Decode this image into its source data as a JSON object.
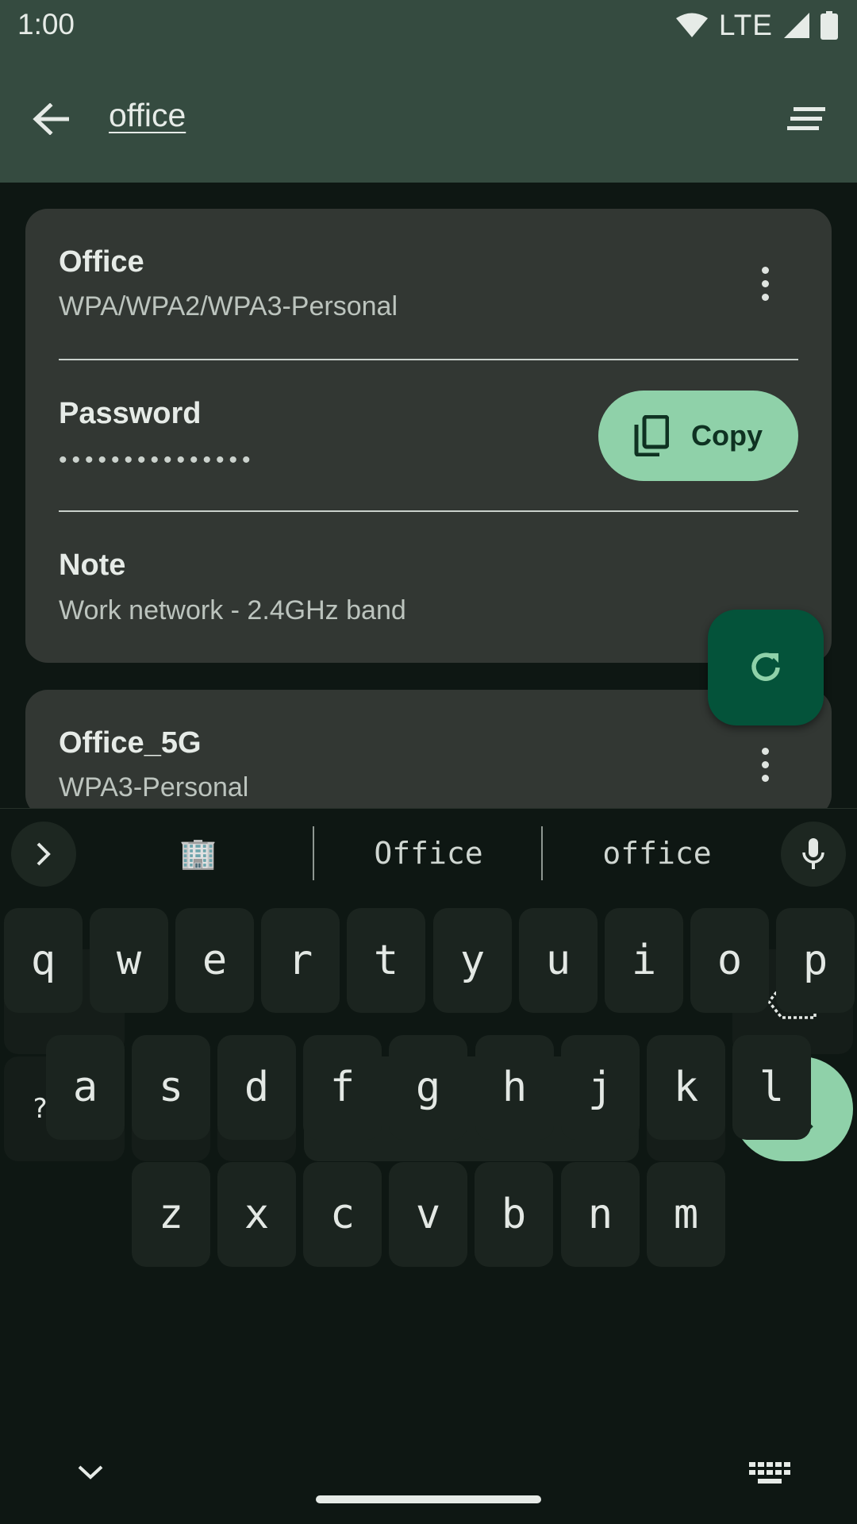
{
  "status_bar": {
    "time": "1:00",
    "network": "LTE",
    "icons": [
      "wifi-icon",
      "signal-icon",
      "battery-icon"
    ]
  },
  "toolbar": {
    "search_query": "office",
    "back_icon": "arrow-back-icon",
    "sort_icon": "sort-icon"
  },
  "networks": [
    {
      "ssid": "Office",
      "security": "WPA/WPA2/WPA3-Personal",
      "password_label": "Password",
      "password_masked": "•••••••••••••••",
      "copy_label": "Copy",
      "note_label": "Note",
      "note": "Work network - 2.4GHz band"
    },
    {
      "ssid": "Office_5G",
      "security": "WPA3-Personal"
    }
  ],
  "fab": {
    "icon": "refresh-icon"
  },
  "keyboard": {
    "suggestions": [
      "🏢",
      "Office",
      "office"
    ],
    "row1": [
      "q",
      "w",
      "e",
      "r",
      "t",
      "y",
      "u",
      "i",
      "o",
      "p"
    ],
    "row2": [
      "a",
      "s",
      "d",
      "f",
      "g",
      "h",
      "j",
      "k",
      "l"
    ],
    "row3": [
      "z",
      "x",
      "c",
      "v",
      "b",
      "n",
      "m"
    ],
    "symbols_label": "?123",
    "comma": ".",
    "period": ".",
    "period_hint": ","
  },
  "colors": {
    "toolbar_bg": "#354b40",
    "card_bg": "#323733",
    "accent": "#8fd1a9",
    "fab_bg": "#04533a",
    "keyboard_bg": "#0e1713",
    "key_bg": "#1b241f"
  }
}
